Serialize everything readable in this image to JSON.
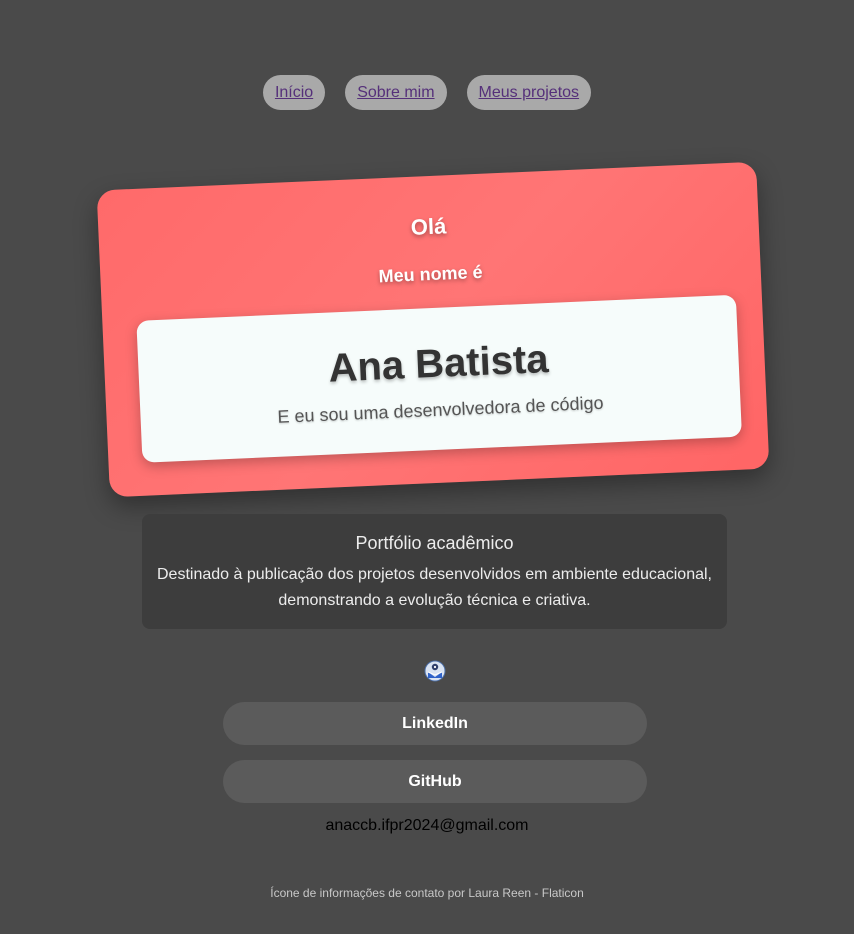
{
  "nav": {
    "items": [
      {
        "label": "Início"
      },
      {
        "label": "Sobre mim"
      },
      {
        "label": "Meus projetos"
      }
    ]
  },
  "hero": {
    "greeting": "Olá",
    "intro": "Meu nome é",
    "name": "Ana Batista",
    "subtitle": "E eu sou uma desenvolvedora de código"
  },
  "info": {
    "title": "Portfólio acadêmico",
    "description": "Destinado à publicação dos projetos desenvolvidos em ambiente educacional, demonstrando a evolução técnica e criativa."
  },
  "contact": {
    "icon": "contact-info-icon",
    "linkedin_label": "LinkedIn",
    "github_label": "GitHub",
    "email": "anaccb.ifpr2024@gmail.com"
  },
  "footer": {
    "credit": "Ícone de informações de contato por Laura Reen - Flaticon"
  },
  "colors": {
    "background": "#4a4a4a",
    "card": "#ff6b6b",
    "name_box": "#f6fcfb",
    "nav_pill": "#a9a9a9",
    "nav_link": "#55307a",
    "button": "#5b5b5b"
  }
}
